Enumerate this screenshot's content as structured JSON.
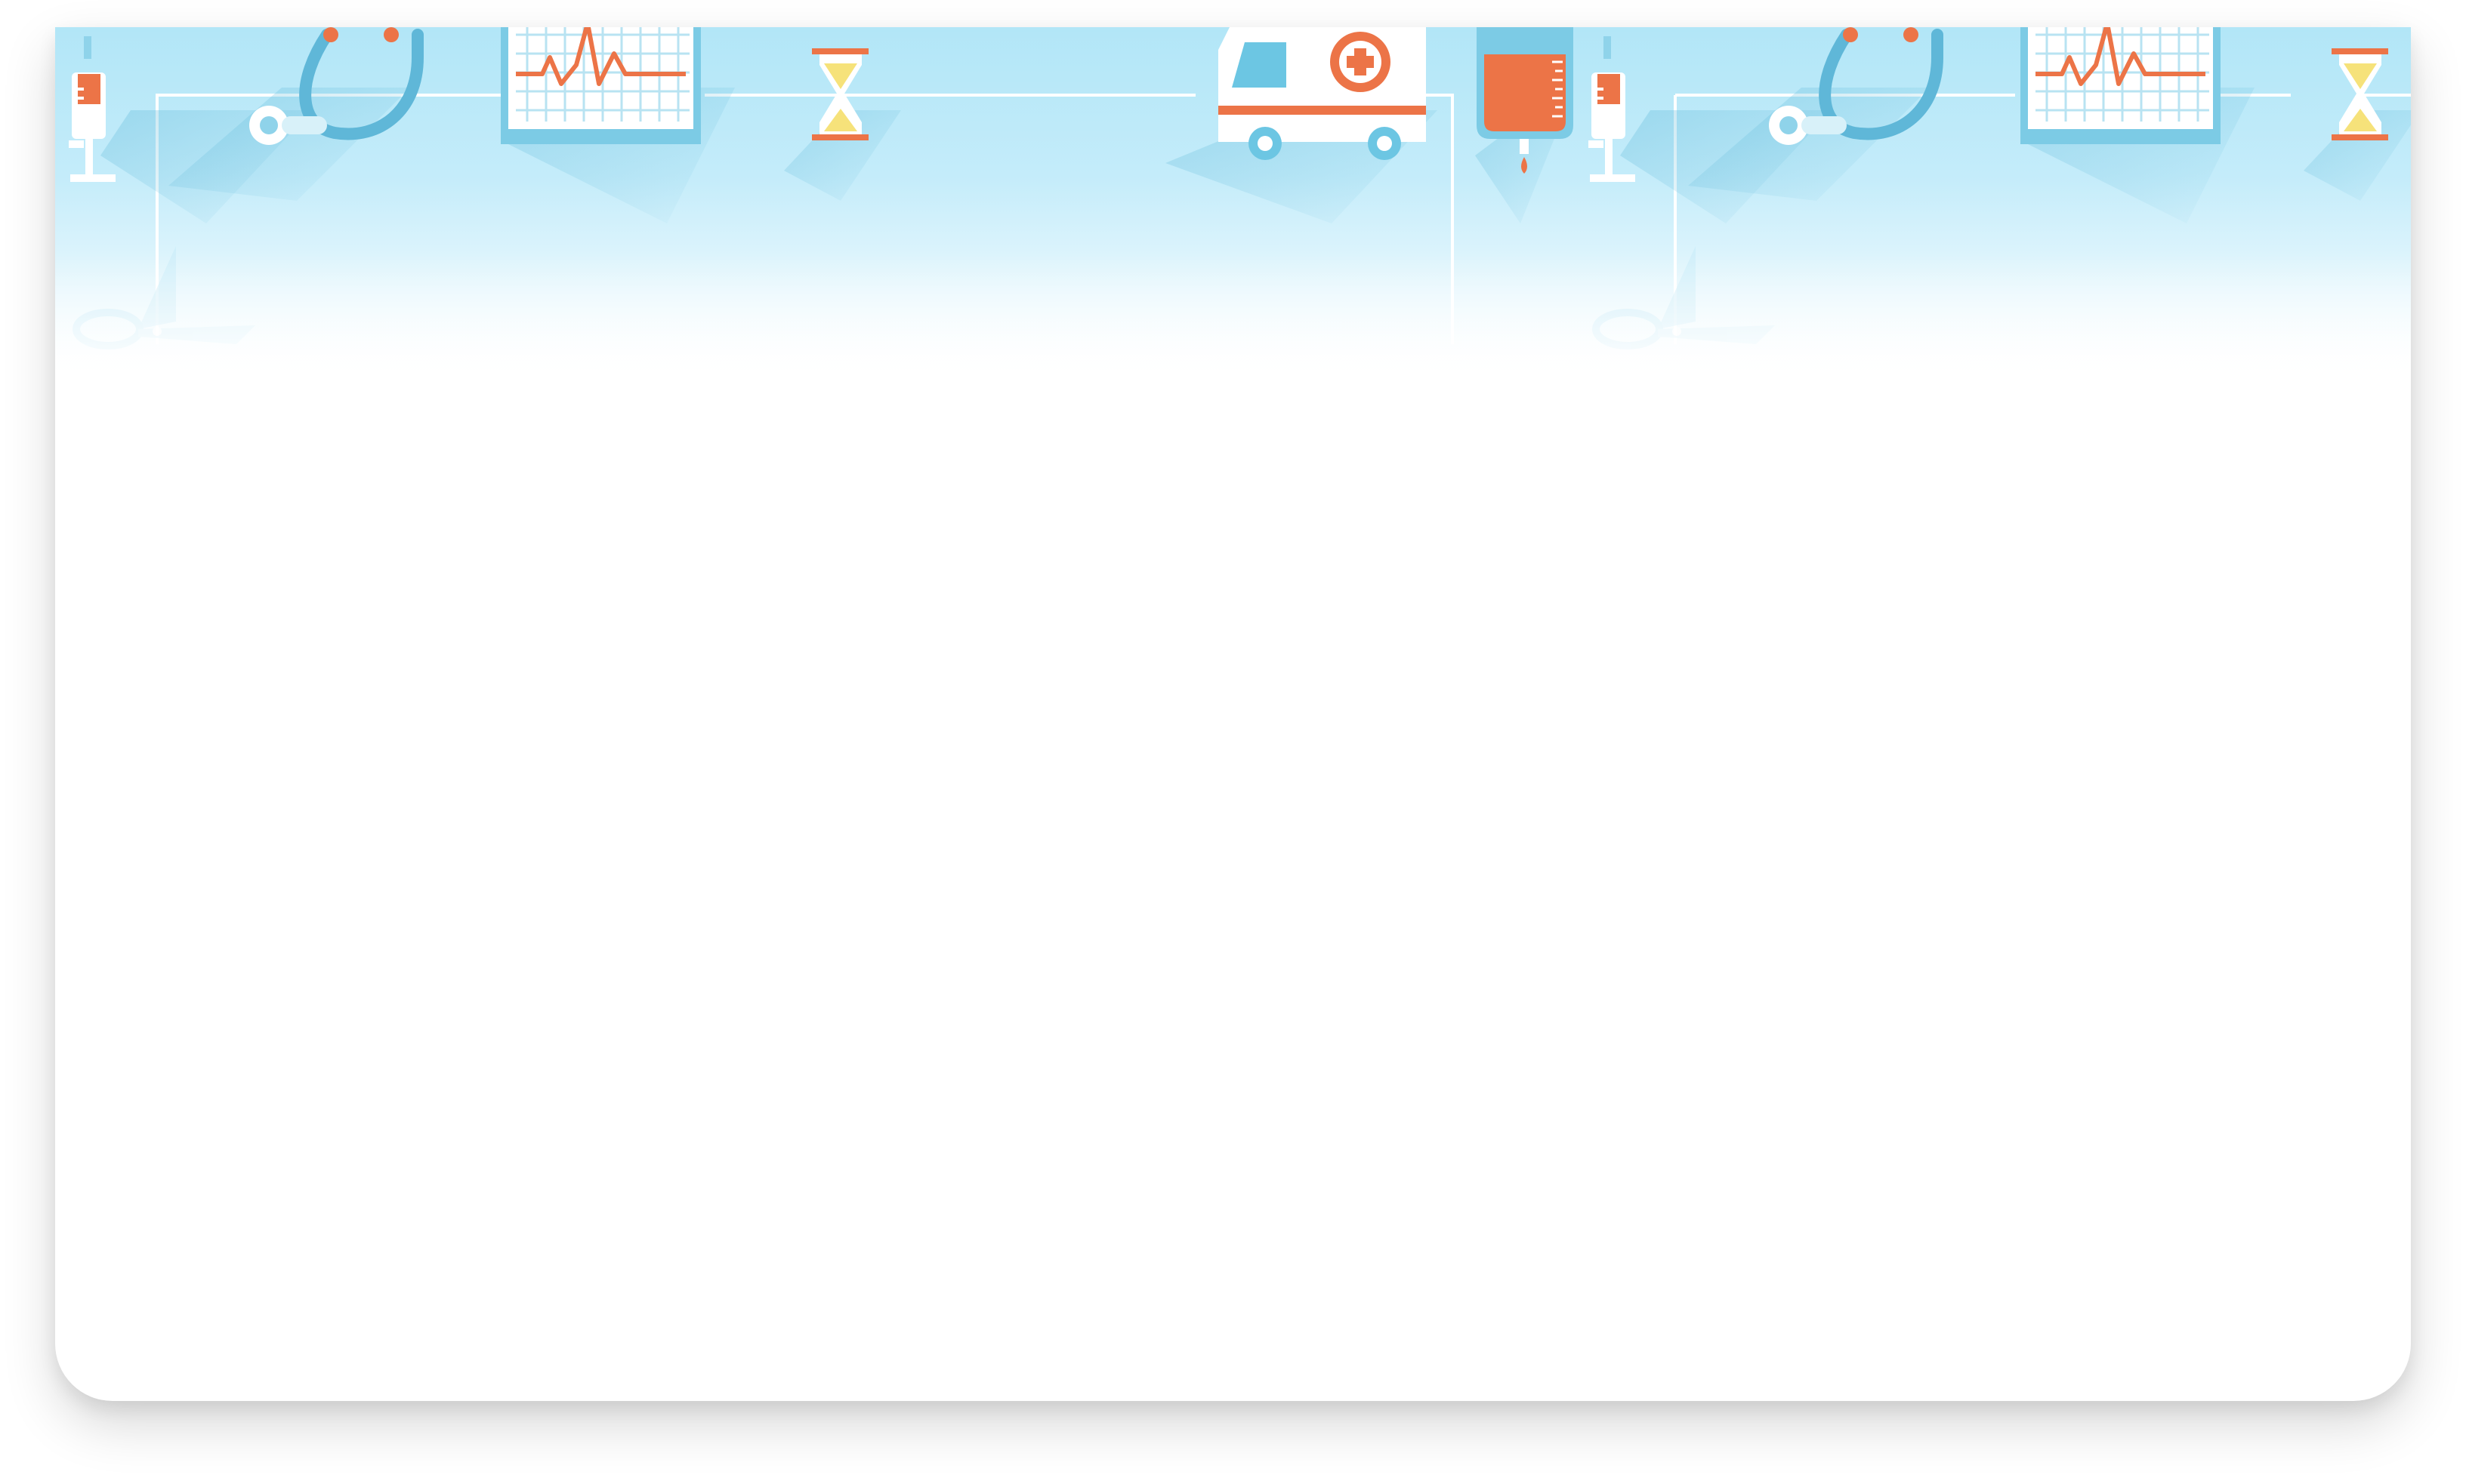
{
  "screen": {
    "background": "#ffffff",
    "card_background": "#ffffff"
  },
  "banner": {
    "theme": "medical",
    "palette": {
      "sky_top": "#b2e6f7",
      "sky_bottom": "#ffffff",
      "line": "#ffffff",
      "icon_blue": "#6cc6e3",
      "icon_orange": "#ec7447",
      "icon_yellow": "#f6e27a"
    },
    "icons": [
      "syringe-icon",
      "stethoscope-icon",
      "heartbeat-monitor-icon",
      "hourglass-icon",
      "ambulance-icon",
      "blood-bag-icon",
      "scissors-icon"
    ]
  }
}
